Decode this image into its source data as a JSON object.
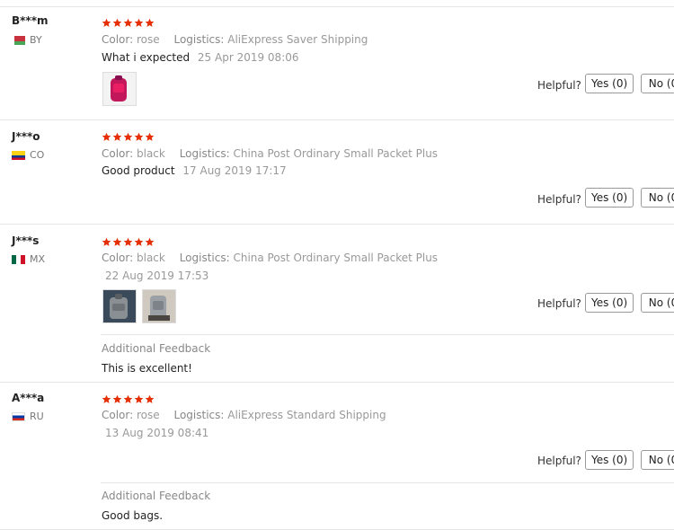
{
  "labels": {
    "color": "Color:",
    "logistics": "Logistics:",
    "helpful": "Helpful?",
    "yes": "Yes (0)",
    "no": "No (0",
    "additional_feedback": "Additional Feedback"
  },
  "colors": {
    "star": "#e62e04",
    "text_muted": "#999999"
  },
  "rating_max": 5,
  "reviews": [
    {
      "user": "B***m",
      "country": "BY",
      "rating": 5,
      "color": "rose",
      "logistics": "AliExpress Saver Shipping",
      "text": "What i expected",
      "date": "25 Apr 2019 08:06",
      "images": [
        "pink-bag-photo"
      ]
    },
    {
      "user": "J***o",
      "country": "CO",
      "rating": 5,
      "color": "black",
      "logistics": "China Post Ordinary Small Packet Plus",
      "text": "Good product",
      "date": "17 Aug 2019 17:17",
      "images": []
    },
    {
      "user": "J***s",
      "country": "MX",
      "rating": 5,
      "color": "black",
      "logistics": "China Post Ordinary Small Packet Plus",
      "text": "",
      "date": "22 Aug 2019 17:53",
      "images": [
        "gray-bag-photo-1",
        "gray-bag-photo-2"
      ],
      "additional_feedback": "This is excellent!"
    },
    {
      "user": "A***a",
      "country": "RU",
      "rating": 5,
      "color": "rose",
      "logistics": "AliExpress Standard Shipping",
      "text": "",
      "date": "13 Aug 2019 08:41",
      "images": [],
      "additional_feedback": "Good bags."
    }
  ]
}
